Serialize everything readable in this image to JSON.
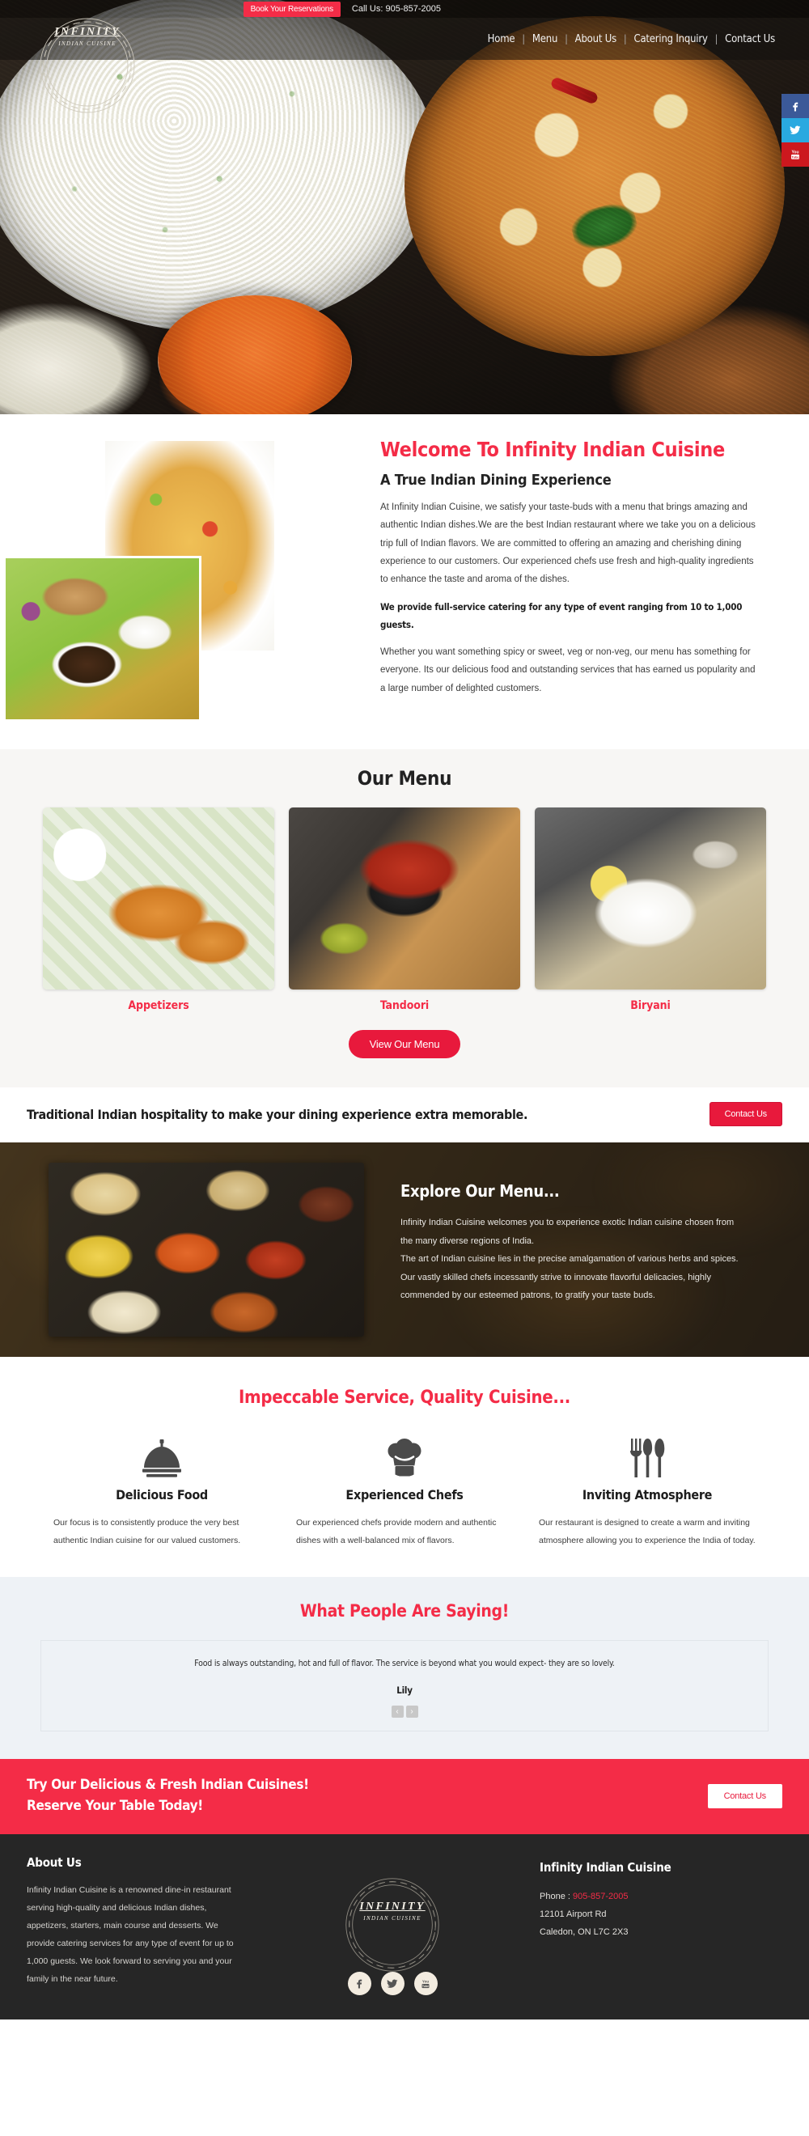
{
  "brand": {
    "logo_line1": "INFINITY",
    "logo_line2": "INDIAN CUISINE",
    "accent_color": "#f42c47",
    "dark_color": "#262626"
  },
  "topbar": {
    "book_label": "Book Your Reservations",
    "call_label": "Call Us: 905-857-2005"
  },
  "nav": {
    "items": [
      {
        "label": "Home"
      },
      {
        "label": "Menu"
      },
      {
        "label": "About Us"
      },
      {
        "label": "Catering Inquiry"
      },
      {
        "label": "Contact Us"
      }
    ],
    "separator": "|"
  },
  "social_rail": [
    {
      "name": "facebook-icon",
      "glyph": "f",
      "color": "#3b5998"
    },
    {
      "name": "twitter-icon",
      "glyph": "🕊",
      "color": "#29a9e0"
    },
    {
      "name": "youtube-icon",
      "glyph": "You",
      "color": "#cc181e"
    }
  ],
  "welcome": {
    "heading": "Welcome To Infinity Indian Cuisine",
    "subheading": "A True Indian Dining Experience",
    "p1": "At Infinity Indian Cuisine, we satisfy your taste-buds with a menu that brings amazing and authentic Indian dishes.We are the best Indian restaurant where we take you on a delicious trip full of Indian flavors. We are committed to offering an amazing and cherishing dining experience to our customers. Our experienced chefs use fresh and high-quality ingredients to enhance the taste and aroma of the dishes.",
    "p2_bold": "We provide full-service catering for any type of event ranging from 10 to 1,000 guests.",
    "p3": "Whether you want something spicy or sweet, veg or non-veg, our menu has something for everyone. Its our delicious food and outstanding services that has earned us popularity and a large number of delighted customers."
  },
  "menu_section": {
    "heading": "Our Menu",
    "cards": [
      {
        "label": "Appetizers",
        "image": "appetizers-photo"
      },
      {
        "label": "Tandoori",
        "image": "tandoori-photo"
      },
      {
        "label": "Biryani",
        "image": "biryani-photo"
      }
    ],
    "button_label": "View Our Menu"
  },
  "hospitality": {
    "text": "Traditional Indian hospitality to make your dining experience extra memorable.",
    "button_label": "Contact Us"
  },
  "explore": {
    "heading": "Explore Our Menu...",
    "p1": "Infinity Indian Cuisine welcomes you to experience exotic Indian cuisine chosen from the many diverse regions of India.",
    "p2": "The art of Indian cuisine lies in the precise amalgamation of various herbs and spices. Our vastly skilled chefs incessantly strive to innovate flavorful delicacies, highly commended by our esteemed patrons, to gratify your taste buds."
  },
  "features": {
    "heading": "Impeccable Service, Quality Cuisine...",
    "items": [
      {
        "icon": "cloche-icon",
        "title": "Delicious Food",
        "text": "Our focus is to consistently produce the very best authentic Indian cuisine for our valued customers."
      },
      {
        "icon": "chef-hat-icon",
        "title": "Experienced Chefs",
        "text": "Our experienced chefs provide modern and authentic dishes with a well-balanced mix of flavors."
      },
      {
        "icon": "cutlery-icon",
        "title": "Inviting Atmosphere",
        "text": "Our restaurant is designed to create a warm and inviting atmosphere allowing you to experience the India of today."
      }
    ]
  },
  "testimonials": {
    "heading": "What People Are Saying!",
    "quote": "Food is always outstanding, hot and full of flavor. The service is beyond what you would expect- they are so lovely.",
    "author": "Lily",
    "prev_glyph": "‹",
    "next_glyph": "›"
  },
  "cta": {
    "line1": "Try Our Delicious & Fresh Indian Cuisines!",
    "line2": "Reserve Your Table Today!",
    "button_label": "Contact Us"
  },
  "footer": {
    "about_title": "About Us",
    "about_text": "Infinity Indian Cuisine is a renowned dine-in restaurant serving high-quality and delicious Indian dishes, appetizers, starters, main course and desserts. We provide catering services for any type of event for up to 1,000 guests. We look forward to serving you and your family in the near future.",
    "contact_title": "Infinity Indian Cuisine",
    "phone_label": "Phone : ",
    "phone_number": "905-857-2005",
    "address_line1": "12101 Airport Rd",
    "address_line2": "Caledon, ON L7C 2X3",
    "social": [
      {
        "name": "facebook-icon",
        "glyph": "f"
      },
      {
        "name": "twitter-icon",
        "glyph": "🕊"
      },
      {
        "name": "youtube-icon",
        "glyph": "You"
      }
    ]
  }
}
